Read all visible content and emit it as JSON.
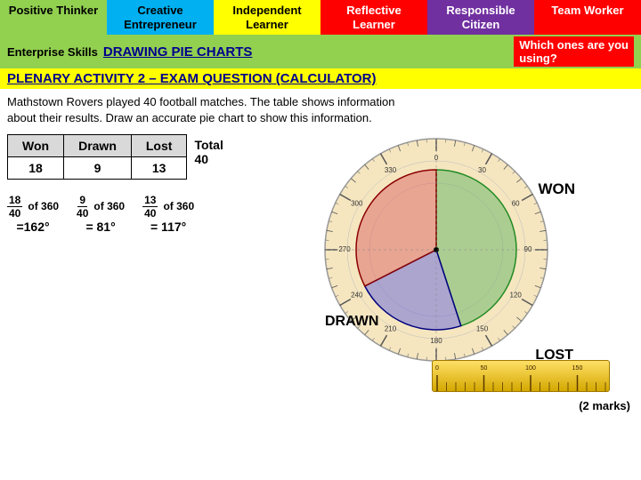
{
  "tabs": [
    {
      "id": "positive",
      "label": "Positive\nThinker",
      "class": "tab-positive"
    },
    {
      "id": "creative",
      "label": "Creative\nEntrepreneur",
      "class": "tab-creative"
    },
    {
      "id": "independent",
      "label": "Independent\nLearner",
      "class": "tab-independent"
    },
    {
      "id": "reflective",
      "label": "Reflective\nLearner",
      "class": "tab-reflective"
    },
    {
      "id": "responsible",
      "label": "Responsible\nCitizen",
      "class": "tab-responsible"
    },
    {
      "id": "team",
      "label": "Team\nWorker",
      "class": "tab-team"
    }
  ],
  "enterprise": {
    "label": "Enterprise Skills",
    "drawing_title": "DRAWING PIE CHARTS",
    "which_ones": "Which ones are you\nusing?"
  },
  "plenary": {
    "title": "PLENARY ACTIVITY 2 – EXAM QUESTION (CALCULATOR)"
  },
  "description": {
    "line1": "Mathstown Rovers played 40 football matches. The table shows information",
    "line2": "about their results. Draw an accurate pie chart to show this information."
  },
  "table": {
    "headers": [
      "Won",
      "Drawn",
      "Lost",
      "Total"
    ],
    "values": [
      "18",
      "9",
      "13",
      "40"
    ]
  },
  "calculations": [
    {
      "numerator": "18",
      "denominator": "40",
      "of": "of 360",
      "result": "=162°"
    },
    {
      "numerator": "9",
      "denominator": "40",
      "of": "of 360",
      "result": "= 81°"
    },
    {
      "numerator": "13",
      "denominator": "40",
      "of": "of 360",
      "result": "= 117°"
    }
  ],
  "pie_labels": {
    "won": "WON",
    "drawn": "DRAWN",
    "lost": "LOST"
  },
  "pie_data": {
    "won_degrees": 162,
    "drawn_degrees": 81,
    "lost_degrees": 117
  },
  "marks": "(2 marks)"
}
